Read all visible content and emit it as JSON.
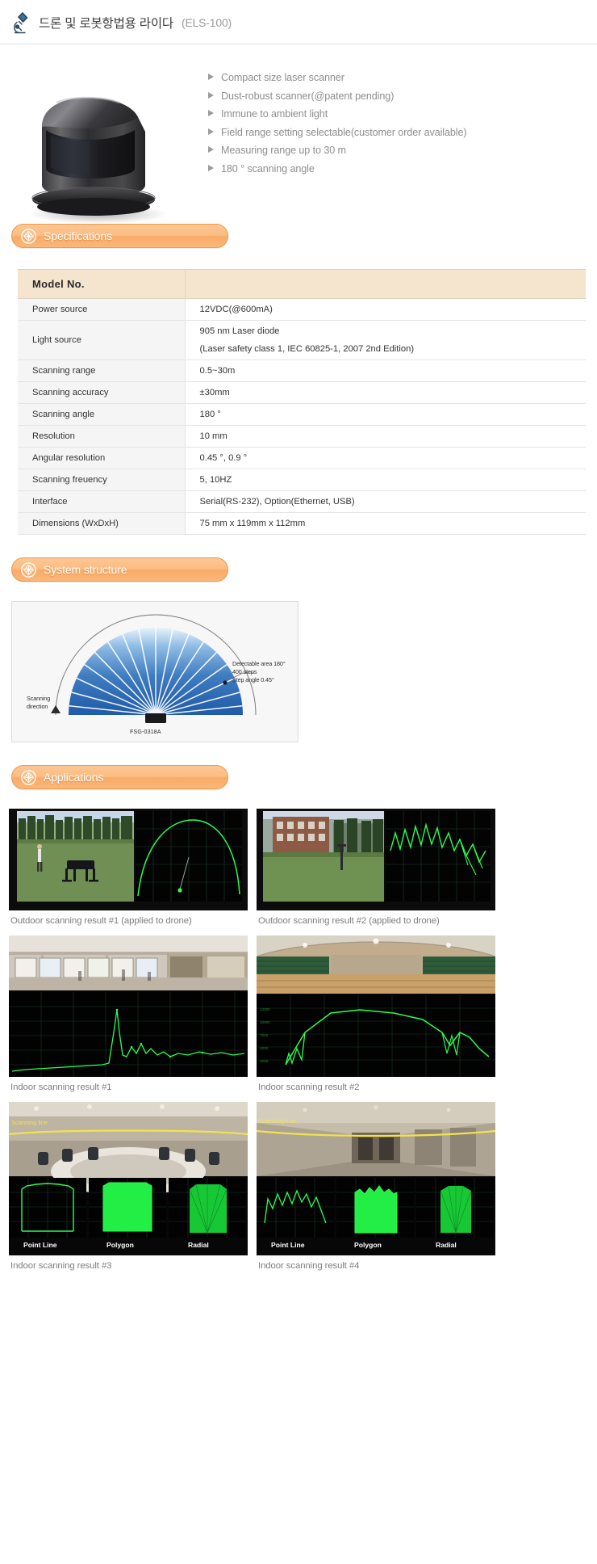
{
  "header": {
    "icon": "microscope-icon",
    "title": "드론 및 로봇항법용 라이다",
    "model": "(ELS-100)"
  },
  "hero": {
    "product_image_alt": "ELS-100 laser scanner unit",
    "features": [
      "Compact size laser scanner",
      "Dust-robust scanner(@patent pending)",
      "Immune to ambient light",
      "Field range setting selectable(customer order available)",
      "Measuring range up to 30 m",
      "180 °   scanning angle"
    ]
  },
  "sections": {
    "specifications": {
      "icon": "hexagon-icon",
      "title": "Specifications"
    },
    "system_structure": {
      "icon": "hexagon-icon",
      "title": "System structure"
    },
    "applications": {
      "icon": "hexagon-icon",
      "title": "Applications"
    }
  },
  "spec_table": {
    "headers": [
      "Model No.",
      ""
    ],
    "rows": [
      {
        "key": "Power source",
        "value": "12VDC(@600mA)",
        "value2": ""
      },
      {
        "key": "Light source",
        "value": "905 nm Laser diode",
        "value2": "(Laser safety class 1, IEC 60825-1, 2007 2nd Edition)"
      },
      {
        "key": "Scanning range",
        "value": "0.5~30m",
        "value2": ""
      },
      {
        "key": "Scanning accuracy",
        "value": "±30mm",
        "value2": ""
      },
      {
        "key": "Scanning angle",
        "value": "180 °",
        "value2": ""
      },
      {
        "key": "Resolution",
        "value": "10 mm",
        "value2": ""
      },
      {
        "key": "Angular resolution",
        "value": "0.45 °, 0.9 °",
        "value2": ""
      },
      {
        "key": "Scanning freuency",
        "value": "5, 10HZ",
        "value2": ""
      },
      {
        "key": "Interface",
        "value": "Serial(RS-232), Option(Ethernet, USB)",
        "value2": ""
      },
      {
        "key": "Dimensions (WxDxH)",
        "value": "75 mm x 119mm x 112mm",
        "value2": ""
      }
    ]
  },
  "system_diagram": {
    "scanning_direction_label": "Scanning\ndirection",
    "scanning_direction_line1": "Scanning",
    "scanning_direction_line2": "direction",
    "detect_line1": "Detectable area 180°",
    "detect_line2": "400 steps",
    "detect_line3": "Step angle 0.45°",
    "device_label": "FSG-0318A",
    "sector_count": 18,
    "detectable_area_deg": 180,
    "steps": 400,
    "step_angle_deg": 0.45
  },
  "applications": [
    {
      "caption": "Outdoor scanning result #1 (applied to drone)",
      "kind": "outdoor-drone-field",
      "overlay_labels": []
    },
    {
      "caption": "Outdoor scanning result #2 (applied to drone)",
      "kind": "outdoor-drone-building",
      "overlay_labels": []
    },
    {
      "caption": "Indoor scanning result #1",
      "kind": "indoor-hall",
      "overlay_labels": []
    },
    {
      "caption": "Indoor scanning result #2",
      "kind": "indoor-gym",
      "overlay_labels": []
    },
    {
      "caption": "Indoor scanning result #3",
      "kind": "indoor-meeting-room",
      "overlay_labels": [
        "Scanning line",
        "Point Line",
        "Polygon",
        "Radial"
      ]
    },
    {
      "caption": "Indoor scanning result #4",
      "kind": "indoor-corridor",
      "overlay_labels": [
        "Scanning line",
        "Point Line",
        "Polygon",
        "Radial"
      ]
    }
  ],
  "colors": {
    "accent_orange": "#f7a95c",
    "header_beige": "#f5e5ce",
    "row_gray": "#f5f5f5",
    "text_gray": "#8e8e8e",
    "scan_green": "#2eff55",
    "diagram_blue": "#2b6cb5"
  }
}
